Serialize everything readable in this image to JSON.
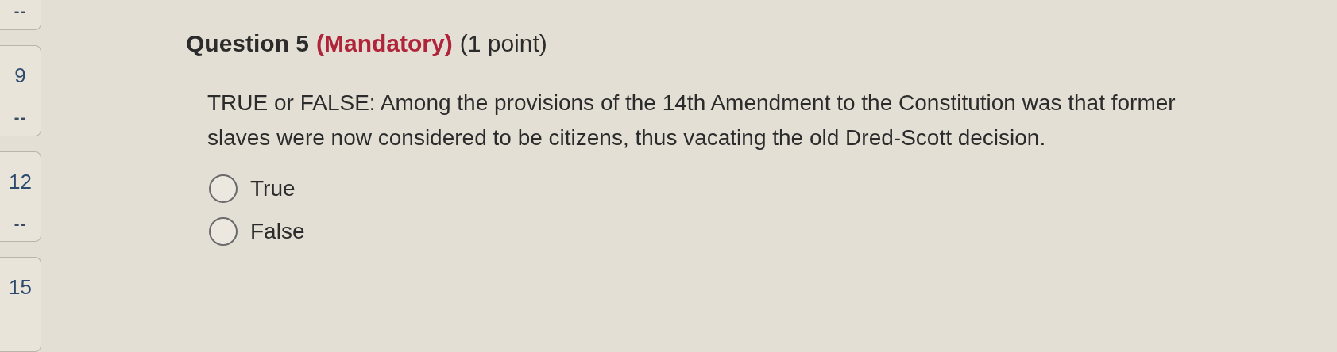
{
  "sidebar": {
    "items": [
      {
        "status": "--"
      },
      {
        "label": "9",
        "status": "--"
      },
      {
        "label": "12",
        "status": "--"
      },
      {
        "label": "15"
      }
    ]
  },
  "question": {
    "title": "Question 5",
    "flag": "(Mandatory)",
    "points": "(1 point)",
    "text": "TRUE or FALSE:  Among the provisions of the 14th Amendment to the Constitution was that former slaves were now considered to be citizens, thus vacating the old Dred-Scott decision.",
    "options": [
      {
        "label": "True",
        "selected": false
      },
      {
        "label": "False",
        "selected": false
      }
    ]
  }
}
